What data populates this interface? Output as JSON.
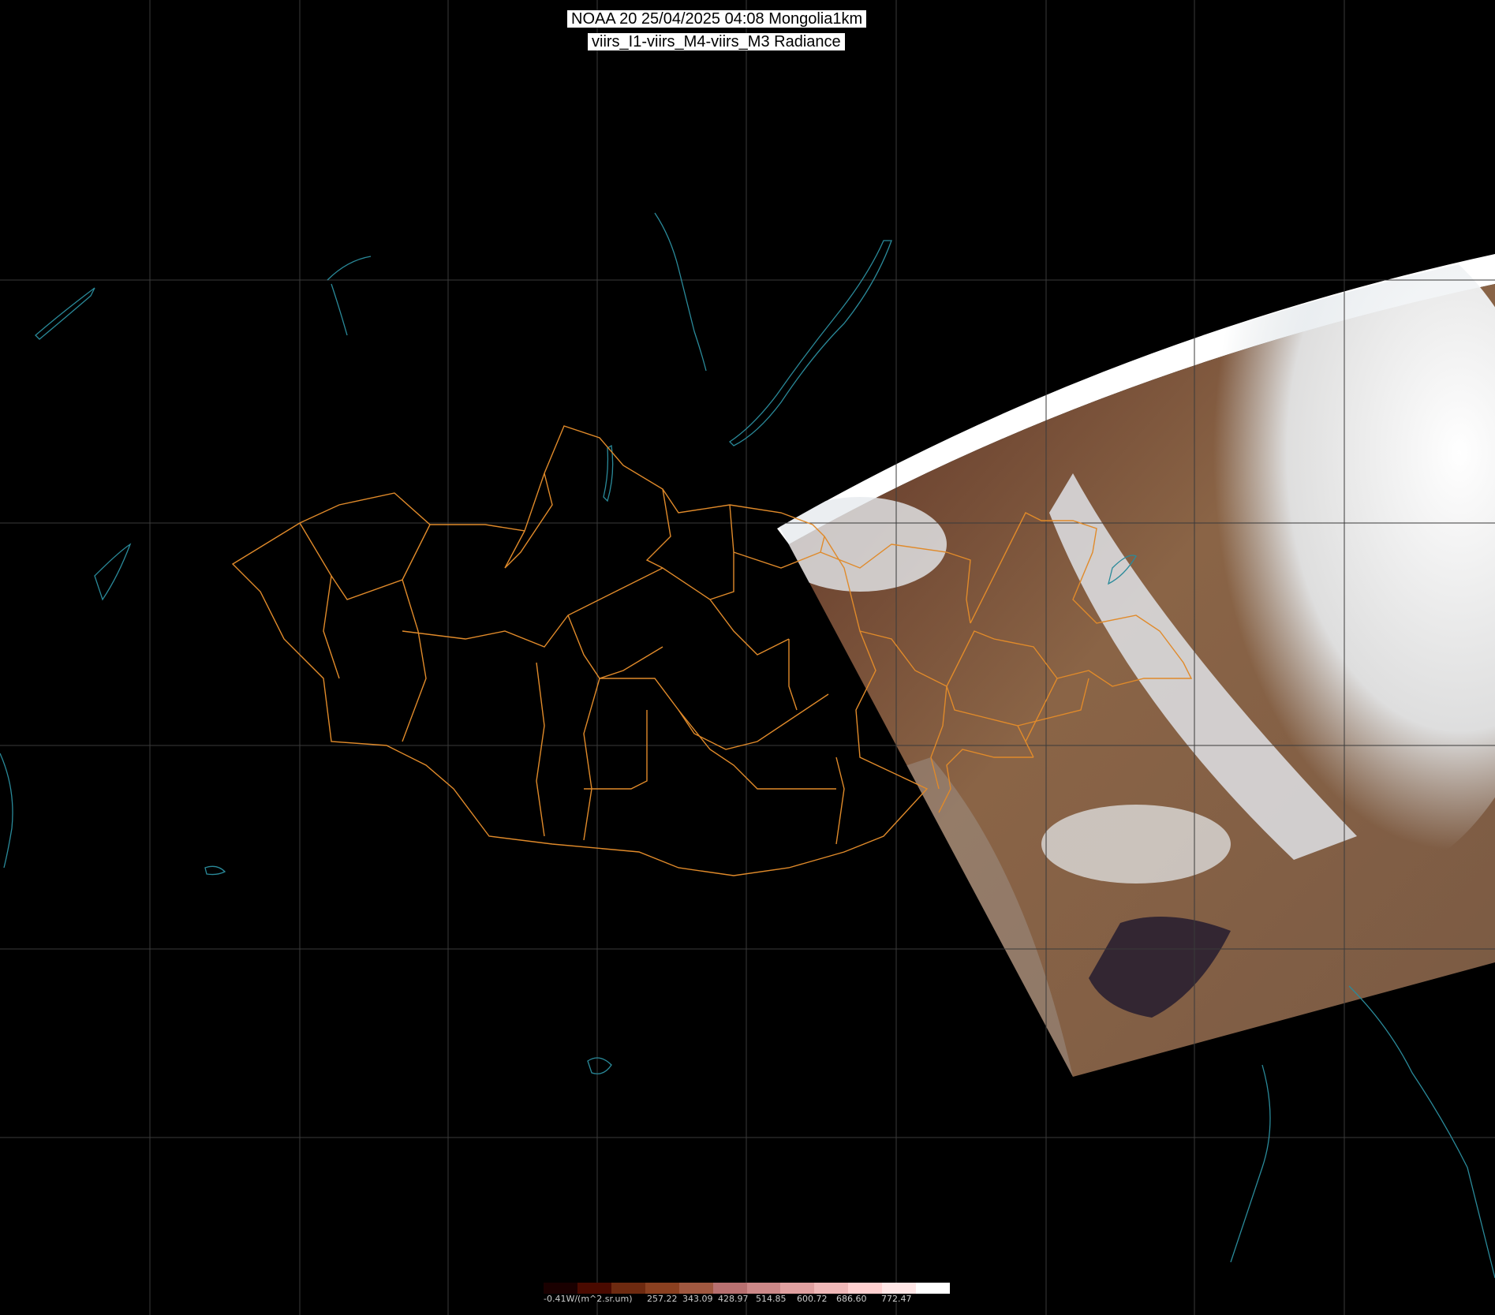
{
  "title": {
    "line1": "NOAA 20 25/04/2025 04:08 Mongolia1km",
    "line2": "viirs_I1-viirs_M4-viirs_M3 Radiance"
  },
  "colorbar": {
    "stops": [
      "#1a0000",
      "#4a0a00",
      "#6e2a10",
      "#8a4020",
      "#a05840",
      "#b87070",
      "#cc8888",
      "#e0a0a0",
      "#f0b8b8",
      "#ffd0d0",
      "#ffe6e6",
      "#ffffff"
    ],
    "labels": [
      "-0.41W/(m^2.sr.um)",
      "257.22",
      "343.09",
      "428.97",
      "514.85",
      "600.72",
      "686.60",
      "772.47"
    ]
  },
  "colors": {
    "background": "#000000",
    "graticule": "#3a3a3a",
    "coastline": "#2a8a9a",
    "border": "#e08a2a",
    "cloud": "#f4f6f8",
    "land": "#6e4a32"
  }
}
